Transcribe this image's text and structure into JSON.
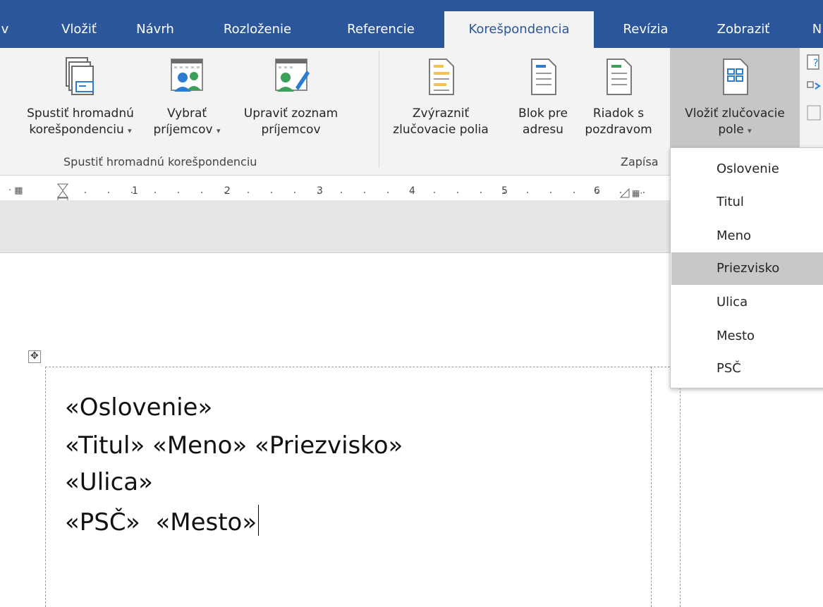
{
  "tabs": [
    {
      "label": "v"
    },
    {
      "label": "Vložiť"
    },
    {
      "label": "Návrh"
    },
    {
      "label": "Rozloženie"
    },
    {
      "label": "Referencie"
    },
    {
      "label": "Korešpondencia"
    },
    {
      "label": "Revízia"
    },
    {
      "label": "Zobraziť"
    },
    {
      "label": "N"
    }
  ],
  "ribbon": {
    "start_merge": {
      "line1": "Spustiť hromadnú",
      "line2": "korešpondenciu"
    },
    "select_recipients": {
      "line1": "Vybrať",
      "line2": "príjemcov"
    },
    "edit_list": {
      "line1": "Upraviť zoznam",
      "line2": "príjemcov"
    },
    "highlight_fields": {
      "line1": "Zvýrazniť",
      "line2": "zlučovacie polia"
    },
    "address_block": {
      "line1": "Blok pre",
      "line2": "adresu"
    },
    "greeting_line": {
      "line1": "Riadok s",
      "line2": "pozdravom"
    },
    "insert_field": {
      "line1": "Vložiť zlučovacie",
      "line2": "pole"
    },
    "group1_label": "Spustiť hromadnú korešpondenciu",
    "group2_label": "Zapísa"
  },
  "ruler": {
    "ticks": [
      "1",
      "2",
      "3",
      "4",
      "5",
      "6"
    ]
  },
  "dropdown": {
    "items": [
      "Oslovenie",
      "Titul",
      "Meno",
      "Priezvisko",
      "Ulica",
      "Mesto",
      "PSČ"
    ],
    "highlighted": "Priezvisko"
  },
  "document": {
    "lines": [
      "«Oslovenie»",
      "«Titul» «Meno» «Priezvisko»",
      "«Ulica»",
      "«PSČ»  «Mesto»"
    ]
  },
  "colors": {
    "accent": "#2b579a",
    "ribbon_bg": "#f3f3f3",
    "highlight": "#c8c8c8"
  }
}
